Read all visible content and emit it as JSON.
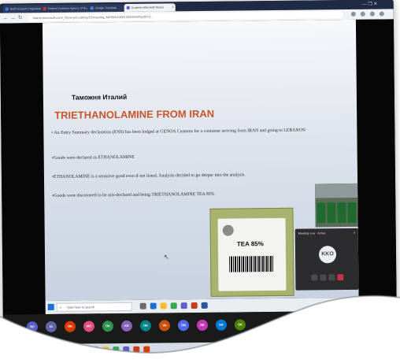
{
  "browser": {
    "tabs": [
      {
        "label": "North Eastern Organization",
        "active": false
      },
      {
        "label": "Federal Customs Agency of Ru...",
        "active": false
      },
      {
        "label": "Google Translate",
        "active": false
      },
      {
        "label": "Customs Microsoft Teams",
        "active": true
      }
    ],
    "url": "teams.microsoft.com/_#/pre-join-calling/19:meeting_MDHkNDA5NTAtNmM2Ny00Y2...",
    "new_tab_symbol": "+",
    "window_controls": "—  ❐  ✕"
  },
  "slide": {
    "organization": "Таможня Италий",
    "title": "TRIETHANOLAMINE FROM IRAN",
    "bullets": [
      "• An Entry Summary declaration (ENS) has been lodged at GENOA Customs for a container arriving from IRAN and going to LEBANON",
      "•Goods were declared as ETHANOLAMINE",
      "•ETHANOLAMINE is a sensitive good even if not listed. Analysts decided to go deeper into the analysis.",
      "•Goods were discovered to be mis-declared and being TRIETHANOLAMINE TEA 85%"
    ],
    "photo_label": "TEA 85%"
  },
  "meeting_window": {
    "title": "Meeting now",
    "status": "Active",
    "avatar_initials": "KKO",
    "close_symbol": "✕"
  },
  "taskbar": {
    "search_placeholder": "Type here to search",
    "search_icon": "⌕"
  },
  "participants": [
    "NS",
    "IA",
    "OK",
    "MO",
    "OK",
    "KK",
    "OK",
    "VA",
    "ON",
    "OK",
    "SK",
    "OK"
  ],
  "colors": {
    "title": "#c8562c",
    "teams_hangup": "#c4314b",
    "participant_palette": [
      "#5b5fc7",
      "#6264a7",
      "#d83b01",
      "#e04d7b",
      "#2f8f4e",
      "#8764b8",
      "#038387",
      "#ca5010",
      "#4f6bed",
      "#c239b3",
      "#0078d4",
      "#498205"
    ]
  }
}
